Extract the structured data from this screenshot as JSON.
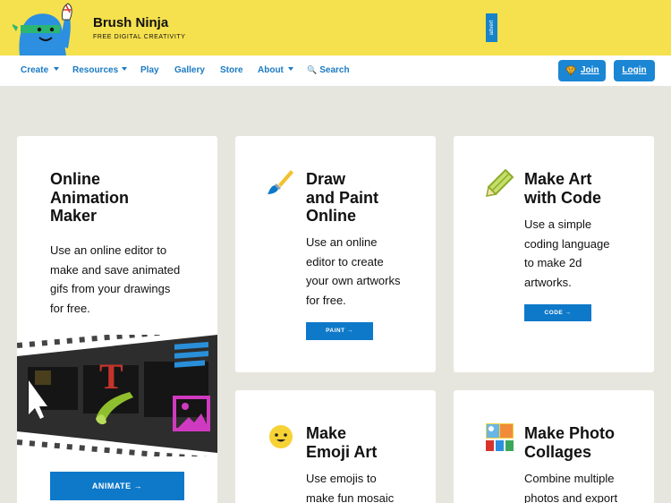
{
  "header": {
    "brand_title": "Brush Ninja",
    "brand_subtitle": "FREE DIGITAL CREATIVITY",
    "advert_label": "advert"
  },
  "nav": {
    "items": [
      {
        "label": "Create",
        "dropdown": true
      },
      {
        "label": "Resources",
        "dropdown": true
      },
      {
        "label": "Play",
        "dropdown": false
      },
      {
        "label": "Gallery",
        "dropdown": false
      },
      {
        "label": "Store",
        "dropdown": false
      },
      {
        "label": "About",
        "dropdown": true
      },
      {
        "label": "Search",
        "icon": "search-icon"
      }
    ],
    "join_label": "Join",
    "login_label": "Login"
  },
  "cards": {
    "animation": {
      "title_lines": [
        "Online",
        "Animation",
        "Maker"
      ],
      "description_lines": [
        "Use an online editor to",
        "make and save animated",
        "gifs from your drawings",
        "for free."
      ],
      "button": "ANIMATE →",
      "icon": "film-strip-illustration"
    },
    "paint": {
      "title_lines": [
        "Draw",
        "and Paint",
        "Online"
      ],
      "description_lines": [
        "Use an online",
        "editor to create",
        "your own artworks",
        "for free."
      ],
      "button": "PAINT →",
      "icon": "paintbrush-icon"
    },
    "code": {
      "title_lines": [
        "Make Art",
        "with Code"
      ],
      "description_lines": [
        "Use a simple",
        "coding language",
        "to make 2d",
        "artworks."
      ],
      "button": "CODE →",
      "icon": "pencil-icon"
    },
    "emoji": {
      "title_lines": [
        "Make",
        "Emoji Art"
      ],
      "description_lines": [
        "Use emojis to",
        "make fun mosaic"
      ],
      "icon": "emoji-face-icon"
    },
    "collage": {
      "title_lines": [
        "Make Photo",
        "Collages"
      ],
      "description_lines": [
        "Combine multiple",
        "photos and export"
      ],
      "icon": "collage-icon"
    }
  },
  "colors": {
    "header_bg": "#f5e04e",
    "page_bg": "#e7e6de",
    "accent_blue": "#0e79c9",
    "nav_link": "#1a7ac4"
  }
}
